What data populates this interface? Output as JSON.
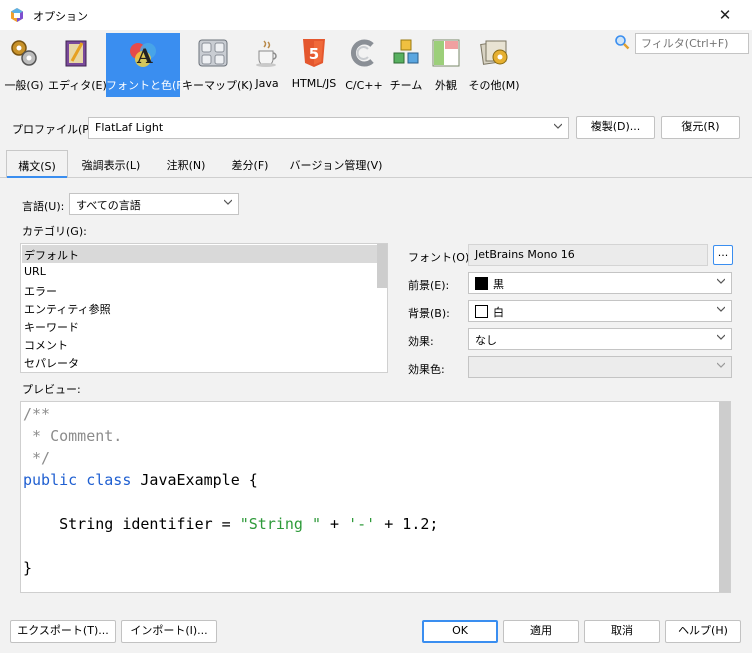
{
  "window": {
    "title": "オプション"
  },
  "toolbar": {
    "categories": [
      {
        "label": "一般(G)",
        "icon": "gears-icon"
      },
      {
        "label": "エディタ(E)",
        "icon": "editor-book-icon"
      },
      {
        "label": "フォントと色(F)",
        "icon": "fonts-colors-icon"
      },
      {
        "label": "キーマップ(K)",
        "icon": "keyboard-icon"
      },
      {
        "label": "Java",
        "icon": "java-cup-icon"
      },
      {
        "label": "HTML/JS",
        "icon": "html5-icon"
      },
      {
        "label": "C/C++",
        "icon": "cpp-icon"
      },
      {
        "label": "チーム",
        "icon": "team-cubes-icon"
      },
      {
        "label": "外観",
        "icon": "appearance-icon"
      },
      {
        "label": "その他(M)",
        "icon": "misc-icon"
      }
    ],
    "search_placeholder": "フィルタ(Ctrl+F)"
  },
  "profile": {
    "label": "プロファイル(P):",
    "value": "FlatLaf Light",
    "duplicate_label": "複製(D)...",
    "restore_label": "復元(R)"
  },
  "tabs": [
    "構文(S)",
    "強調表示(L)",
    "注釈(N)",
    "差分(F)",
    "バージョン管理(V)"
  ],
  "syntax": {
    "language_label": "言語(U):",
    "language_value": "すべての言語",
    "category_label": "カテゴリ(G):",
    "categories": [
      "デフォルト",
      "URL",
      "エラー",
      "エンティティ参照",
      "キーワード",
      "コメント",
      "セパレータ"
    ],
    "font_label": "フォント(O):",
    "font_value": "JetBrains Mono 16",
    "font_button": "...",
    "foreground_label": "前景(E):",
    "foreground_value": "黒",
    "background_label": "背景(B):",
    "background_value": "白",
    "effect_label": "効果:",
    "effect_value": "なし",
    "effect_color_label": "効果色:",
    "preview_label": "プレビュー:"
  },
  "preview_code": {
    "l1": "/**",
    "l2": " * Comment.",
    "l3": " */",
    "l4_kw1": "public",
    "l4_kw2": "class",
    "l4_rest": " JavaExample {",
    "l6_a": "    String identifier = ",
    "l6_str1": "\"String \"",
    "l6_b": " + ",
    "l6_str2": "'-'",
    "l6_c": " + 1.2;",
    "l8": "}"
  },
  "buttons": {
    "export": "エクスポート(T)...",
    "import": "インポート(I)...",
    "ok": "OK",
    "apply": "適用",
    "cancel": "取消",
    "help": "ヘルプ(H)"
  },
  "colors": {
    "accent": "#3a8ef0",
    "foreground_swatch": "#000000",
    "background_swatch": "#ffffff"
  }
}
